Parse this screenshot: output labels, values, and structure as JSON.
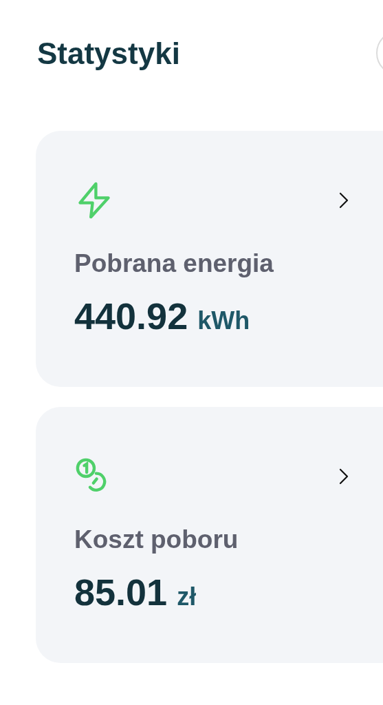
{
  "title": "Statystyki",
  "cards": [
    {
      "kind": "energy",
      "label": "Pobrana energia",
      "value": "440.92",
      "unit": "kWh"
    },
    {
      "kind": "cost",
      "label": "Koszt poboru",
      "value": "85.01",
      "unit": "zł"
    }
  ]
}
